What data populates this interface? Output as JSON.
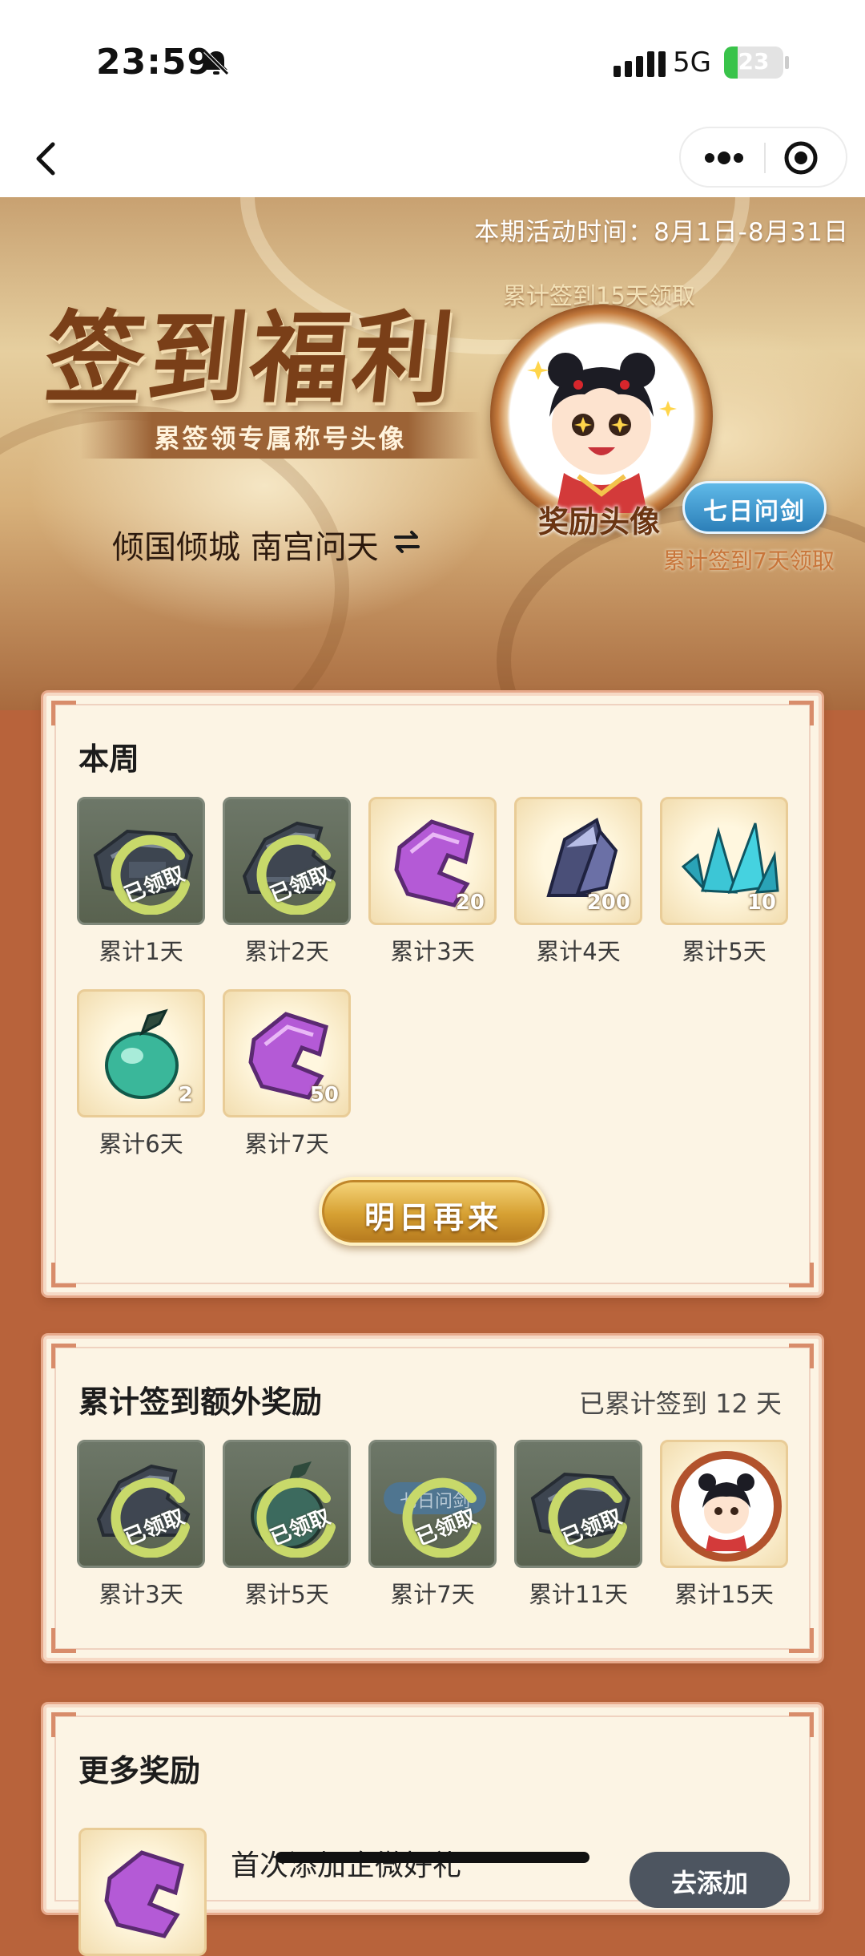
{
  "status_bar": {
    "time": "23:59",
    "network": "5G",
    "battery": "23",
    "battery_level": 0.23
  },
  "nav": {
    "back_icon": "chevron-left-icon",
    "more_icon": "ellipsis-icon",
    "close_icon": "target-close-icon"
  },
  "banner": {
    "period": "本期活动时间：8月1日-8月31日",
    "title": "签到福利",
    "subtitle": "累签领专属称号头像",
    "player_name": "倾国倾城 南宫问天",
    "swap_icon": "swap-arrows-icon",
    "avatar_requirement": "累计签到15天领取",
    "avatar_label": "奖励头像",
    "title_badge": "七日问剑",
    "title_requirement": "累计签到7天领取"
  },
  "weekly": {
    "title": "本周",
    "items": [
      {
        "label": "累计1天",
        "status": "claimed",
        "claimed_text": "已领取",
        "icon": "armor-shoulder-icon"
      },
      {
        "label": "累计2天",
        "status": "claimed",
        "claimed_text": "已领取",
        "icon": "armor-boot-icon"
      },
      {
        "label": "累计3天",
        "status": "pending",
        "qty": "20",
        "icon": "purple-jade-icon"
      },
      {
        "label": "累计4天",
        "status": "pending",
        "qty": "200",
        "icon": "dark-crystal-icon"
      },
      {
        "label": "累计5天",
        "status": "pending",
        "qty": "10",
        "icon": "blue-crystal-icon"
      },
      {
        "label": "累计6天",
        "status": "pending",
        "qty": "2",
        "icon": "jade-gourd-icon"
      },
      {
        "label": "累计7天",
        "status": "pending",
        "qty": "50",
        "icon": "purple-jade-icon"
      }
    ],
    "button": "明日再来"
  },
  "cumulative": {
    "title": "累计签到额外奖励",
    "count_text": "已累计签到 12 天",
    "items": [
      {
        "label": "累计3天",
        "status": "claimed",
        "claimed_text": "已领取",
        "icon": "armor-boot-icon"
      },
      {
        "label": "累计5天",
        "status": "claimed",
        "claimed_text": "已领取",
        "icon": "jade-gourd-icon"
      },
      {
        "label": "累计7天",
        "status": "claimed",
        "claimed_text": "已领取",
        "icon": "title-badge-icon",
        "badge_text": "七日问剑"
      },
      {
        "label": "累计11天",
        "status": "claimed",
        "claimed_text": "已领取",
        "icon": "armor-shoulder-icon"
      },
      {
        "label": "累计15天",
        "status": "pending",
        "icon": "avatar-frame-icon"
      }
    ]
  },
  "more": {
    "title": "更多奖励",
    "item_text": "首次添加企微好礼",
    "item_button": "去添加",
    "item_icon": "purple-jade-icon"
  },
  "colors": {
    "accent_gold": "#d6a032",
    "card_bg": "#fcf4e4",
    "page_bg": "#b8633b",
    "claimed_green": "#c8d96a"
  }
}
